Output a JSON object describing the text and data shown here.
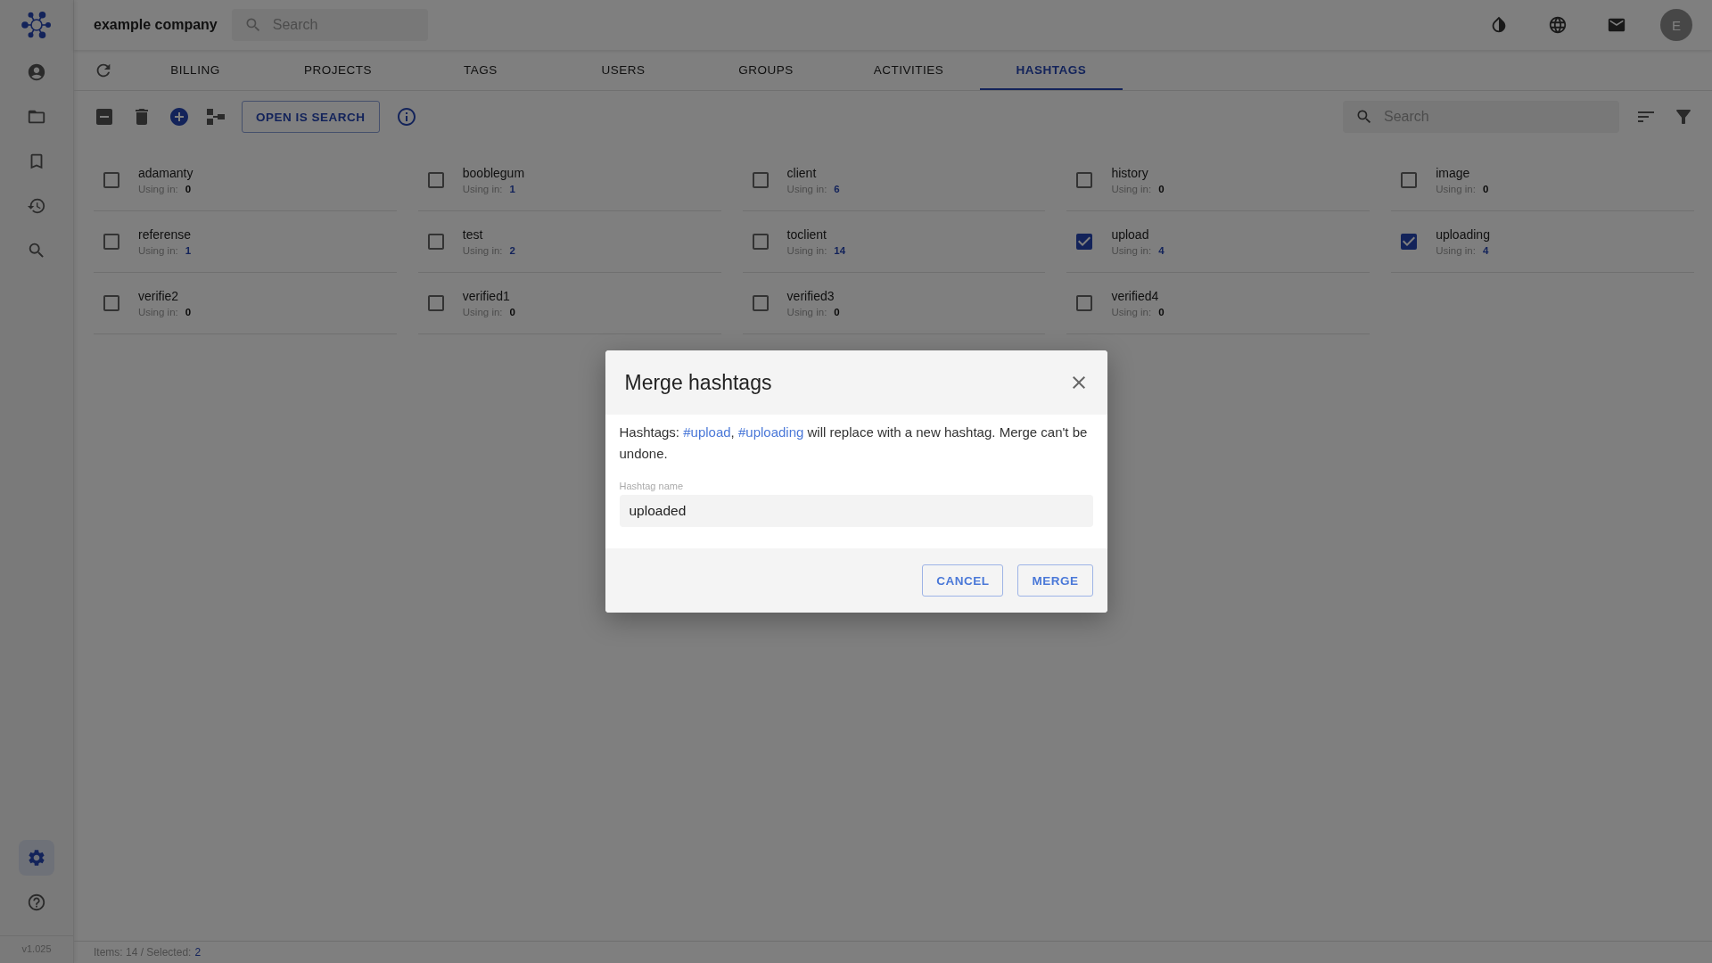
{
  "header": {
    "company": "example company",
    "search": {
      "placeholder": "Search"
    },
    "avatar": "E"
  },
  "sidebar": {
    "items": [
      {
        "kind": "account",
        "selected": false
      },
      {
        "kind": "folder",
        "selected": false
      },
      {
        "kind": "bookmark",
        "selected": false
      },
      {
        "kind": "history",
        "selected": false
      },
      {
        "kind": "search",
        "selected": false
      }
    ],
    "bottom_items": [
      {
        "kind": "settings",
        "selected": true
      },
      {
        "kind": "help",
        "selected": false
      }
    ],
    "version": "v1.025"
  },
  "tabs": [
    {
      "label": "BILLING",
      "selected": false
    },
    {
      "label": "PROJECTS",
      "selected": false
    },
    {
      "label": "TAGS",
      "selected": false
    },
    {
      "label": "USERS",
      "selected": false
    },
    {
      "label": "GROUPS",
      "selected": false
    },
    {
      "label": "ACTIVITIES",
      "selected": false
    },
    {
      "label": "HASHTAGS",
      "selected": true
    }
  ],
  "toolbar": {
    "open_button": "OPEN IS SEARCH",
    "search": {
      "placeholder": "Search"
    }
  },
  "hashtags": [
    {
      "name": "adamanty",
      "using_label": "Using in:",
      "count": "0",
      "used": false,
      "checked": false
    },
    {
      "name": "booblegum",
      "using_label": "Using in:",
      "count": "1",
      "used": true,
      "checked": false
    },
    {
      "name": "client",
      "using_label": "Using in:",
      "count": "6",
      "used": true,
      "checked": false
    },
    {
      "name": "history",
      "using_label": "Using in:",
      "count": "0",
      "used": false,
      "checked": false
    },
    {
      "name": "image",
      "using_label": "Using in:",
      "count": "0",
      "used": false,
      "checked": false
    },
    {
      "name": "referense",
      "using_label": "Using in:",
      "count": "1",
      "used": true,
      "checked": false
    },
    {
      "name": "test",
      "using_label": "Using in:",
      "count": "2",
      "used": true,
      "checked": false
    },
    {
      "name": "toclient",
      "using_label": "Using in:",
      "count": "14",
      "used": true,
      "checked": false
    },
    {
      "name": "upload",
      "using_label": "Using in:",
      "count": "4",
      "used": true,
      "checked": true
    },
    {
      "name": "uploading",
      "using_label": "Using in:",
      "count": "4",
      "used": true,
      "checked": true
    },
    {
      "name": "verifie2",
      "using_label": "Using in:",
      "count": "0",
      "used": false,
      "checked": false
    },
    {
      "name": "verified1",
      "using_label": "Using in:",
      "count": "0",
      "used": false,
      "checked": false
    },
    {
      "name": "verified3",
      "using_label": "Using in:",
      "count": "0",
      "used": false,
      "checked": false
    },
    {
      "name": "verified4",
      "using_label": "Using in:",
      "count": "0",
      "used": false,
      "checked": false
    }
  ],
  "status_bar": {
    "items_label": "Items: 14 / Selected:",
    "selected_count": "2"
  },
  "dialog": {
    "title": "Merge hashtags",
    "message": [
      {
        "kind": "plain",
        "text": "Hashtags: "
      },
      {
        "kind": "link",
        "text": "#upload"
      },
      {
        "kind": "plain",
        "text": ", "
      },
      {
        "kind": "link",
        "text": "#uploading"
      },
      {
        "kind": "plain",
        "text": " will replace with a new hashtag. Merge can't be undone."
      }
    ],
    "field": {
      "label": "Hashtag name",
      "value": "uploaded"
    },
    "buttons": [
      "CANCEL",
      "MERGE"
    ]
  }
}
